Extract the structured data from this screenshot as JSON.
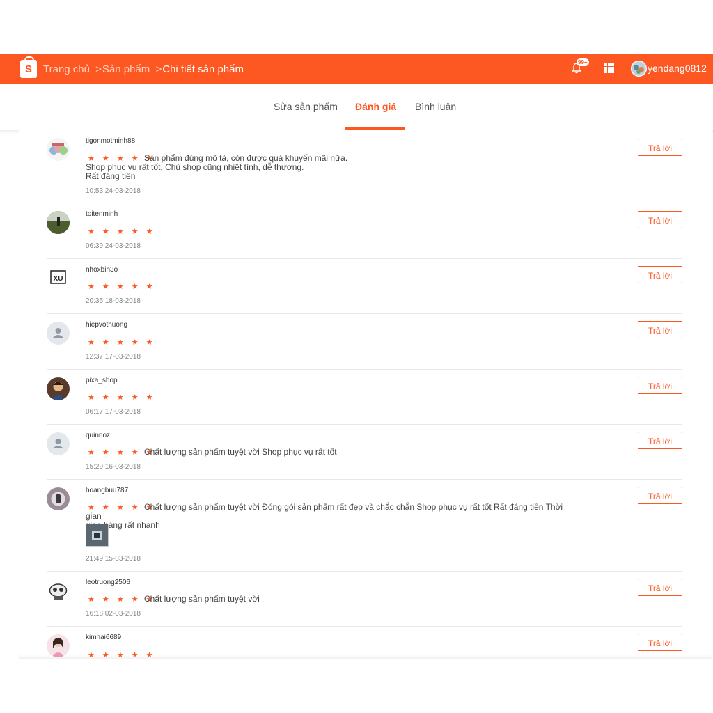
{
  "header": {
    "logo_letter": "S",
    "breadcrumb": [
      {
        "label": "Trang chủ"
      },
      {
        "label": "Sản phẩm"
      },
      {
        "label": "Chi tiết sản phẩm"
      }
    ],
    "notification_count": "99+",
    "username": "yendang0812",
    "accent": "#fd5722"
  },
  "tabs": [
    {
      "label": "Sửa sản phẩm",
      "active": false
    },
    {
      "label": "Đánh giá",
      "active": true
    },
    {
      "label": "Bình luận",
      "active": false
    }
  ],
  "reply_label": "Trả lời",
  "star_glyph": "★ ★ ★ ★ ★",
  "reviews": [
    {
      "username": "tigonmotminh88",
      "rating": 5,
      "comment": "Sản phẩm đúng mô tả, còn được quà khuyến mãi nữa.\nShop phục vụ rất tốt, Chủ shop cũng nhiệt tình, dễ thương.\nRất đáng tiền",
      "time": "10:53 24-03-2018"
    },
    {
      "username": "toitenminh",
      "rating": 5,
      "comment": "",
      "time": "06:39 24-03-2018"
    },
    {
      "username": "nhoxbih3o",
      "rating": 5,
      "comment": "",
      "time": "20:35 18-03-2018"
    },
    {
      "username": "hiepvothuong",
      "rating": 5,
      "comment": "",
      "time": "12:37 17-03-2018"
    },
    {
      "username": "pixa_shop",
      "rating": 5,
      "comment": "",
      "time": "06:17 17-03-2018"
    },
    {
      "username": "quinnoz",
      "rating": 5,
      "comment": "Chất lượng sản phẩm tuyệt vời Shop phục vụ rất tốt",
      "time": "15:29 16-03-2018"
    },
    {
      "username": "hoangbuu787",
      "rating": 5,
      "comment": "Chất lượng sản phẩm tuyệt vời Đóng gói sản phẩm rất đẹp và chắc chắn Shop phục vụ rất tốt Rất đáng tiền Thời gian\ngiao hàng rất nhanh",
      "time": "21:49 15-03-2018"
    },
    {
      "username": "leotruong2506",
      "rating": 5,
      "comment": "Chất lượng sản phẩm tuyệt vời",
      "time": "16:18 02-03-2018"
    },
    {
      "username": "kimhai6689",
      "rating": 5,
      "comment": "",
      "time": ""
    }
  ]
}
